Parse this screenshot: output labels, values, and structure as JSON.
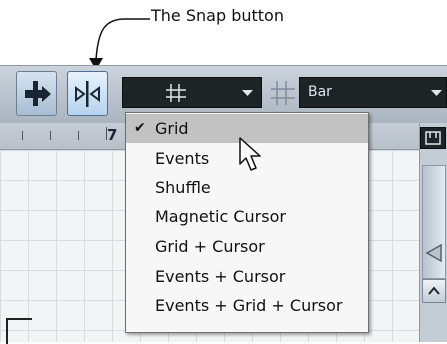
{
  "callout": {
    "text": "The Snap button"
  },
  "toolbar": {
    "quantize_dropdown_value": "",
    "grid_type_value": "Bar"
  },
  "ruler": {
    "bar_label": "7"
  },
  "snap_menu": {
    "items": [
      {
        "label": "Grid",
        "checked": true
      },
      {
        "label": "Events",
        "checked": false
      },
      {
        "label": "Shuffle",
        "checked": false
      },
      {
        "label": "Magnetic Cursor",
        "checked": false
      },
      {
        "label": "Grid + Cursor",
        "checked": false
      },
      {
        "label": "Events + Cursor",
        "checked": false
      },
      {
        "label": "Events + Grid + Cursor",
        "checked": false
      }
    ]
  },
  "icons": {
    "glue_tool": "insert-tool-icon",
    "snap": "snap-icon",
    "grid": "grid-icon",
    "dropdown": "dropdown-arrow-icon",
    "mouse_pointer": "mouse-pointer-icon",
    "scroll_up": "scroll-up-icon",
    "zoom_slider": "zoom-slider-icon",
    "editor_icon": "editor-window-icon"
  }
}
